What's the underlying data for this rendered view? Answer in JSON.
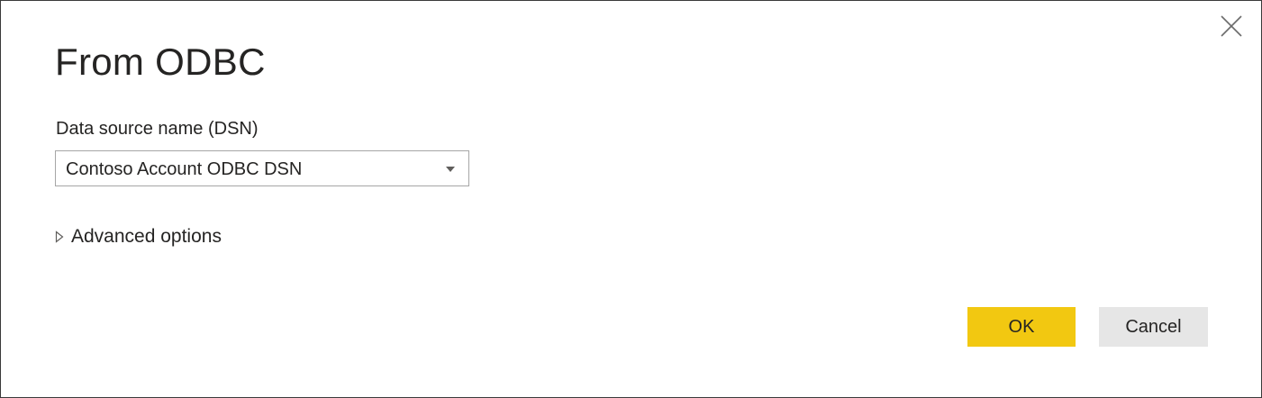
{
  "dialog": {
    "title": "From ODBC",
    "close_icon": "close-icon"
  },
  "dsn": {
    "label": "Data source name (DSN)",
    "selected_value": "Contoso Account ODBC DSN",
    "dropdown_icon": "chevron-down-icon"
  },
  "advanced": {
    "label": "Advanced options",
    "expand_icon": "triangle-right-icon",
    "expanded": false
  },
  "buttons": {
    "ok_label": "OK",
    "cancel_label": "Cancel",
    "ok_color": "#F2C811",
    "cancel_color": "#E6E6E6"
  }
}
